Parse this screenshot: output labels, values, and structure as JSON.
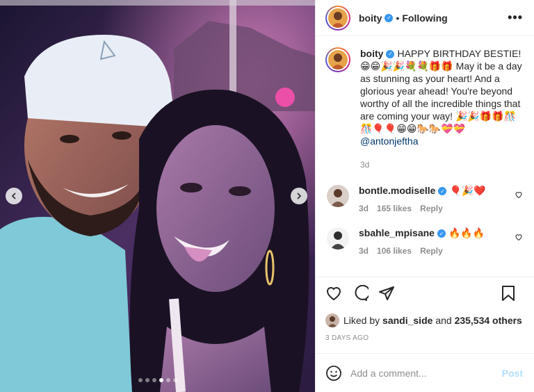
{
  "post": {
    "username": "boity",
    "separator": "•",
    "follow_status": "Following",
    "more_label": "•••",
    "caption": {
      "username": "boity",
      "text": "HAPPY BIRTHDAY BESTIE! 😁😁🎉🎉💐💐🎁🎁 May it be a day as stunning as your heart! And a glorious year ahead! You're beyond worthy of all the incredible things that are coming your way! 🎉🎉🎁🎁🎊🎊🎈🎈😁😁🐎🐎💝💝",
      "mention": "@antonjeftha",
      "time": "3d"
    },
    "comments": [
      {
        "username": "bontle.modiselle",
        "text": "🎈🎉❤️",
        "time": "3d",
        "likes": "165 likes",
        "reply": "Reply"
      },
      {
        "username": "sbahle_mpisane",
        "text": "🔥🔥🔥",
        "time": "3d",
        "likes": "106 likes",
        "reply": "Reply"
      }
    ],
    "liked_by": {
      "prefix": "Liked by",
      "user": "sandi_side",
      "middle": "and",
      "others": "235,534 others"
    },
    "posted_ago": "3 DAYS AGO",
    "comment_input": {
      "placeholder": "Add a comment...",
      "value": ""
    },
    "post_label": "Post",
    "carousel": {
      "count": 6,
      "active": 3
    },
    "colors": {
      "accent": "#3897f0",
      "link": "#00376b",
      "muted": "#8e8e8e",
      "post_disabled": "#b2dffc"
    }
  }
}
